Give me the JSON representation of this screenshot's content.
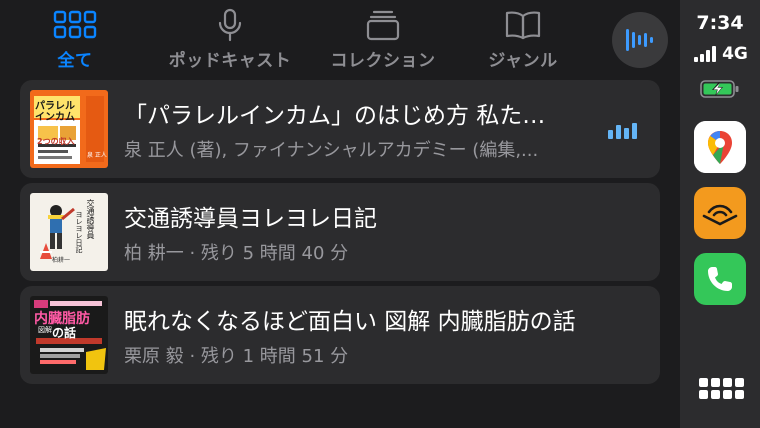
{
  "tabs": [
    {
      "label": "全て",
      "icon": "grid-icon",
      "active": true
    },
    {
      "label": "ポッドキャスト",
      "icon": "microphone-icon",
      "active": false
    },
    {
      "label": "コレクション",
      "icon": "collection-icon",
      "active": false
    },
    {
      "label": "ジャンル",
      "icon": "book-icon",
      "active": false
    }
  ],
  "now_playing": {
    "icon": "now-playing-waveform-icon"
  },
  "items": [
    {
      "title": "「パラレルインカム」のはじめ方 私た…",
      "subtitle": "泉 正人 (著), ファイナンシャルアカデミー (編集,...",
      "playing": true,
      "cover": {
        "bg": "#f26a1b",
        "line1": "パラレル",
        "line2": "インカム",
        "line3": "2つの収入",
        "line4": "泉 正人"
      }
    },
    {
      "title": "交通誘導員ヨレヨレ日記",
      "subtitle": "柏 耕一 · 残り 5 時間 40 分",
      "playing": false,
      "cover": {
        "bg": "#f4f1ea",
        "line1": "交通誘導員",
        "line2": "ヨレヨレ日記",
        "line3": "柏耕一"
      }
    },
    {
      "title": "眠れなくなるほど面白い 図解 内臓脂肪の話",
      "subtitle": "栗原 毅 · 残り 1 時間 51 分",
      "playing": false,
      "cover": {
        "bg": "#1a1a1a",
        "line1": "内臓脂肪",
        "line2": "の話",
        "line3": "図解"
      }
    }
  ],
  "status": {
    "time": "7:34",
    "network": "4G",
    "signal_bars": 4,
    "battery": "charging"
  },
  "apps": [
    {
      "name": "Google Maps",
      "icon": "google-maps-icon"
    },
    {
      "name": "Audible",
      "icon": "audible-icon"
    },
    {
      "name": "Phone",
      "icon": "phone-icon"
    }
  ],
  "colors": {
    "accent": "#0a84ff",
    "background": "#1c1c1e",
    "card": "#2c2c2e",
    "secondary_text": "#98989d"
  }
}
